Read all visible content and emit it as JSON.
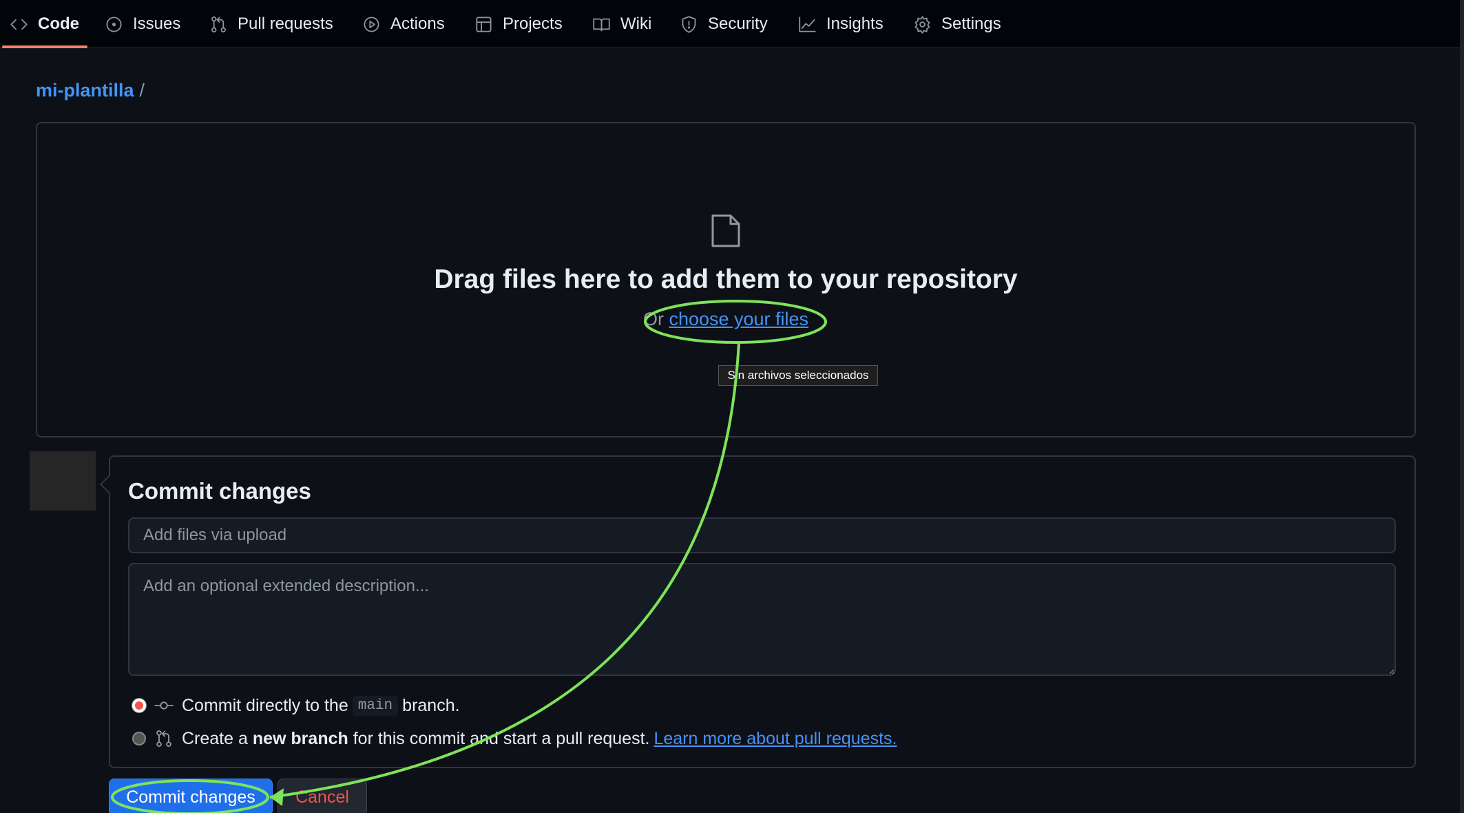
{
  "nav": {
    "tabs": [
      {
        "label": "Code",
        "icon": "code-icon"
      },
      {
        "label": "Issues",
        "icon": "issue-icon"
      },
      {
        "label": "Pull requests",
        "icon": "pull-request-icon"
      },
      {
        "label": "Actions",
        "icon": "play-icon"
      },
      {
        "label": "Projects",
        "icon": "table-icon"
      },
      {
        "label": "Wiki",
        "icon": "book-icon"
      },
      {
        "label": "Security",
        "icon": "shield-icon"
      },
      {
        "label": "Insights",
        "icon": "graph-icon"
      },
      {
        "label": "Settings",
        "icon": "gear-icon"
      }
    ],
    "active": "Code"
  },
  "breadcrumb": {
    "repo": "mi-plantilla",
    "separator": "/"
  },
  "upload": {
    "title": "Drag files here to add them to your repository",
    "or_text": "Or",
    "choose_link": "choose your files",
    "file_status": "Sin archivos seleccionados"
  },
  "commit": {
    "heading": "Commit changes",
    "summary_placeholder": "Add files via upload",
    "description_placeholder": "Add an optional extended description...",
    "option_direct": {
      "prefix": "Commit directly to the",
      "branch": "main",
      "suffix": "branch.",
      "selected": true
    },
    "option_new": {
      "prefix": "Create a",
      "bold": "new branch",
      "suffix": "for this commit and start a pull request.",
      "link": "Learn more about pull requests.",
      "selected": false
    },
    "commit_button": "Commit changes",
    "cancel_button": "Cancel"
  },
  "annotation": {
    "color": "#7ee35a"
  },
  "colors": {
    "background": "#0d1117",
    "link": "#4493f8",
    "primary_button": "#1f6feb",
    "danger": "#f85149"
  }
}
